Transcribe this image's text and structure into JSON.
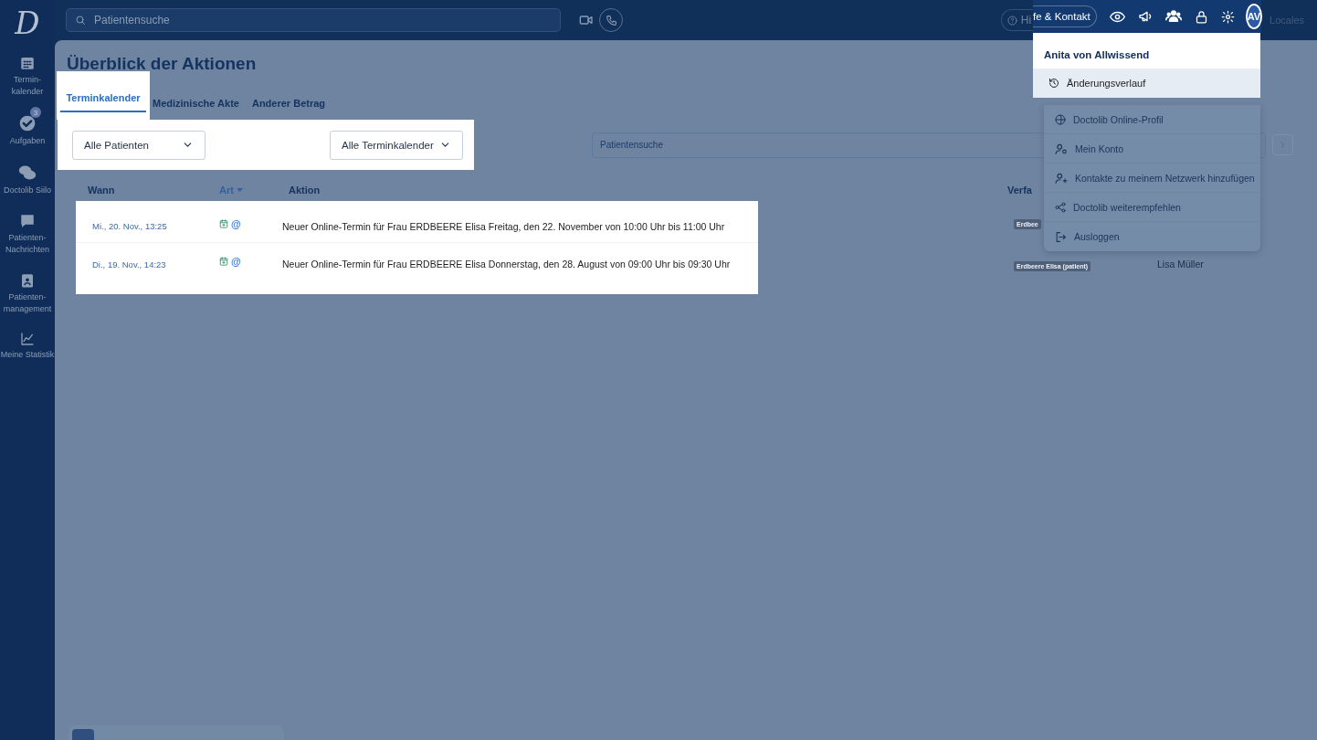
{
  "logo": "D",
  "sidebar": {
    "items": [
      {
        "label_lines": [
          "Termin-",
          "kalender"
        ]
      },
      {
        "label_lines": [
          "Aufgaben"
        ],
        "badge": "3"
      },
      {
        "label_lines": [
          "Doctolib Siilo"
        ]
      },
      {
        "label_lines": [
          "Patienten-",
          "Nachrichten"
        ]
      },
      {
        "label_lines": [
          "Patienten-",
          "management"
        ]
      },
      {
        "label_lines": [
          "Meine Statistik"
        ]
      }
    ]
  },
  "topbar": {
    "search": {
      "placeholder": "Patientensuche"
    },
    "help_button": "Hi",
    "contact_button": "fe & Kontakt",
    "avatar": "AV",
    "locales": "Locales"
  },
  "page": {
    "title": "Überblick der Aktionen",
    "tabs": [
      {
        "label": "Terminkalender",
        "selected": true
      },
      {
        "label": "Medizinische Akte",
        "selected": false
      },
      {
        "label": "Anderer Betrag",
        "selected": false
      }
    ],
    "filters": [
      "Alle Patienten",
      "Alle Terminkalender"
    ],
    "patient_search": {
      "placeholder": "Patientensuche"
    },
    "table": {
      "columns": [
        "Wann",
        "Art",
        "Aktion",
        "Verfa"
      ],
      "rows": [
        {
          "when": "Mi., 20. Nov., 13:25",
          "type_symbol": "@",
          "action": "Neuer Online-Termin für Frau ERDBEERE Elisa Freitag, den 22. November von 10:00 Uhr bis 11:00 Uhr",
          "tag": "Erdbee"
        },
        {
          "when": "Di., 19. Nov., 14:23",
          "type_symbol": "@",
          "action": "Neuer Online-Termin für Frau ERDBEERE Elisa Donnerstag, den 28. August von 09:00 Uhr bis 09:30 Uhr",
          "tag": "Erdbeere Elisa (patient)",
          "author": "Lisa Müller"
        }
      ]
    }
  },
  "user_menu": {
    "name": "Anita von Allwissend",
    "items": [
      {
        "label": "Änderungsverlauf",
        "selected": true,
        "spotlight": true
      },
      {
        "label": "Doctolib Online-Profil",
        "selected": false,
        "spotlight": false
      },
      {
        "label": "Mein Konto",
        "selected": false,
        "spotlight": false
      },
      {
        "label": "Kontakte zu meinem Netzwerk hinzufügen",
        "selected": false,
        "spotlight": false
      },
      {
        "label": "Doctolib weiterempfehlen",
        "selected": false,
        "spotlight": false
      },
      {
        "label": "Ausloggen",
        "selected": false,
        "spotlight": false
      }
    ]
  }
}
